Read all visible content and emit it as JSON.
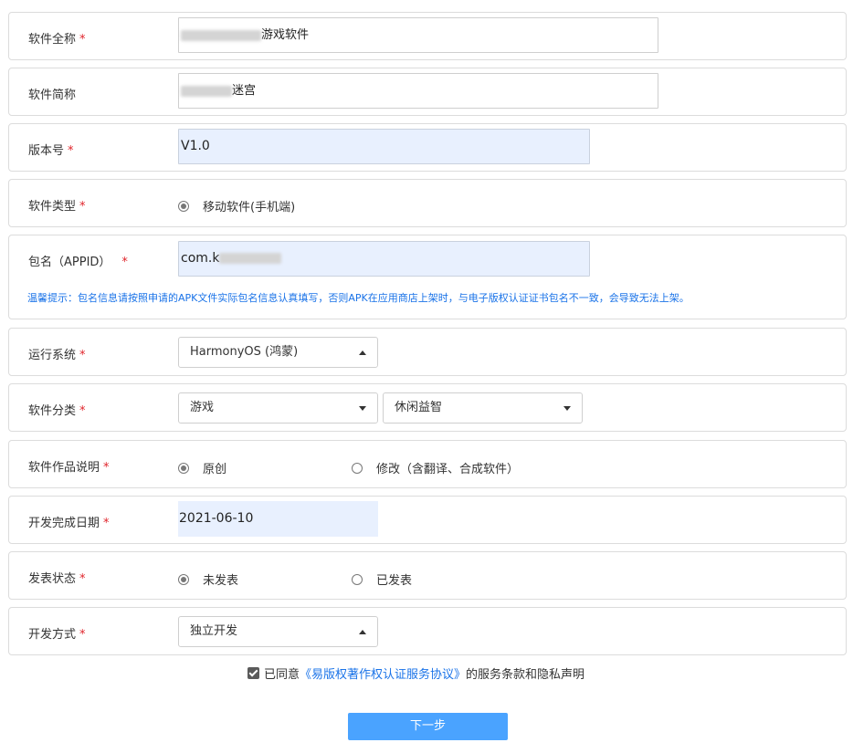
{
  "form": {
    "full_name": {
      "label": "软件全称",
      "required": "*",
      "value": "游戏软件"
    },
    "short_name": {
      "label": "软件简称",
      "value": "迷宫"
    },
    "version": {
      "label": "版本号",
      "required": "*",
      "value": "V1.0"
    },
    "software_type": {
      "label": "软件类型",
      "required": "*",
      "option": "移动软件(手机端)"
    },
    "package_name": {
      "label": "包名（APPID）",
      "required": "*",
      "value": "com.k",
      "hint": "温馨提示：包名信息请按照申请的APK文件实际包名信息认真填写，否则APK在应用商店上架时，与电子版权认证证书包名不一致，会导致无法上架。"
    },
    "os": {
      "label": "运行系统",
      "required": "*",
      "selected": "HarmonyOS (鸿蒙)"
    },
    "category": {
      "label": "软件分类",
      "required": "*",
      "primary": "游戏",
      "secondary": "休闲益智"
    },
    "work_desc": {
      "label": "软件作品说明",
      "required": "*",
      "option_original": "原创",
      "option_modified": "修改（含翻译、合成软件）"
    },
    "finish_date": {
      "label": "开发完成日期",
      "required": "*",
      "value": "2021-06-10"
    },
    "publish_status": {
      "label": "发表状态",
      "required": "*",
      "option_unpublished": "未发表",
      "option_published": "已发表"
    },
    "dev_mode": {
      "label": "开发方式",
      "required": "*",
      "selected": "独立开发"
    }
  },
  "agreement": {
    "prefix": "已同意",
    "link": "《易版权著作权认证服务协议》",
    "suffix": "的服务条款和隐私声明"
  },
  "next_button": "下一步",
  "colors": {
    "accent": "#4aa3ff",
    "link": "#1a73e8",
    "required": "#e0242b",
    "autofill": "#e8f0fe"
  }
}
